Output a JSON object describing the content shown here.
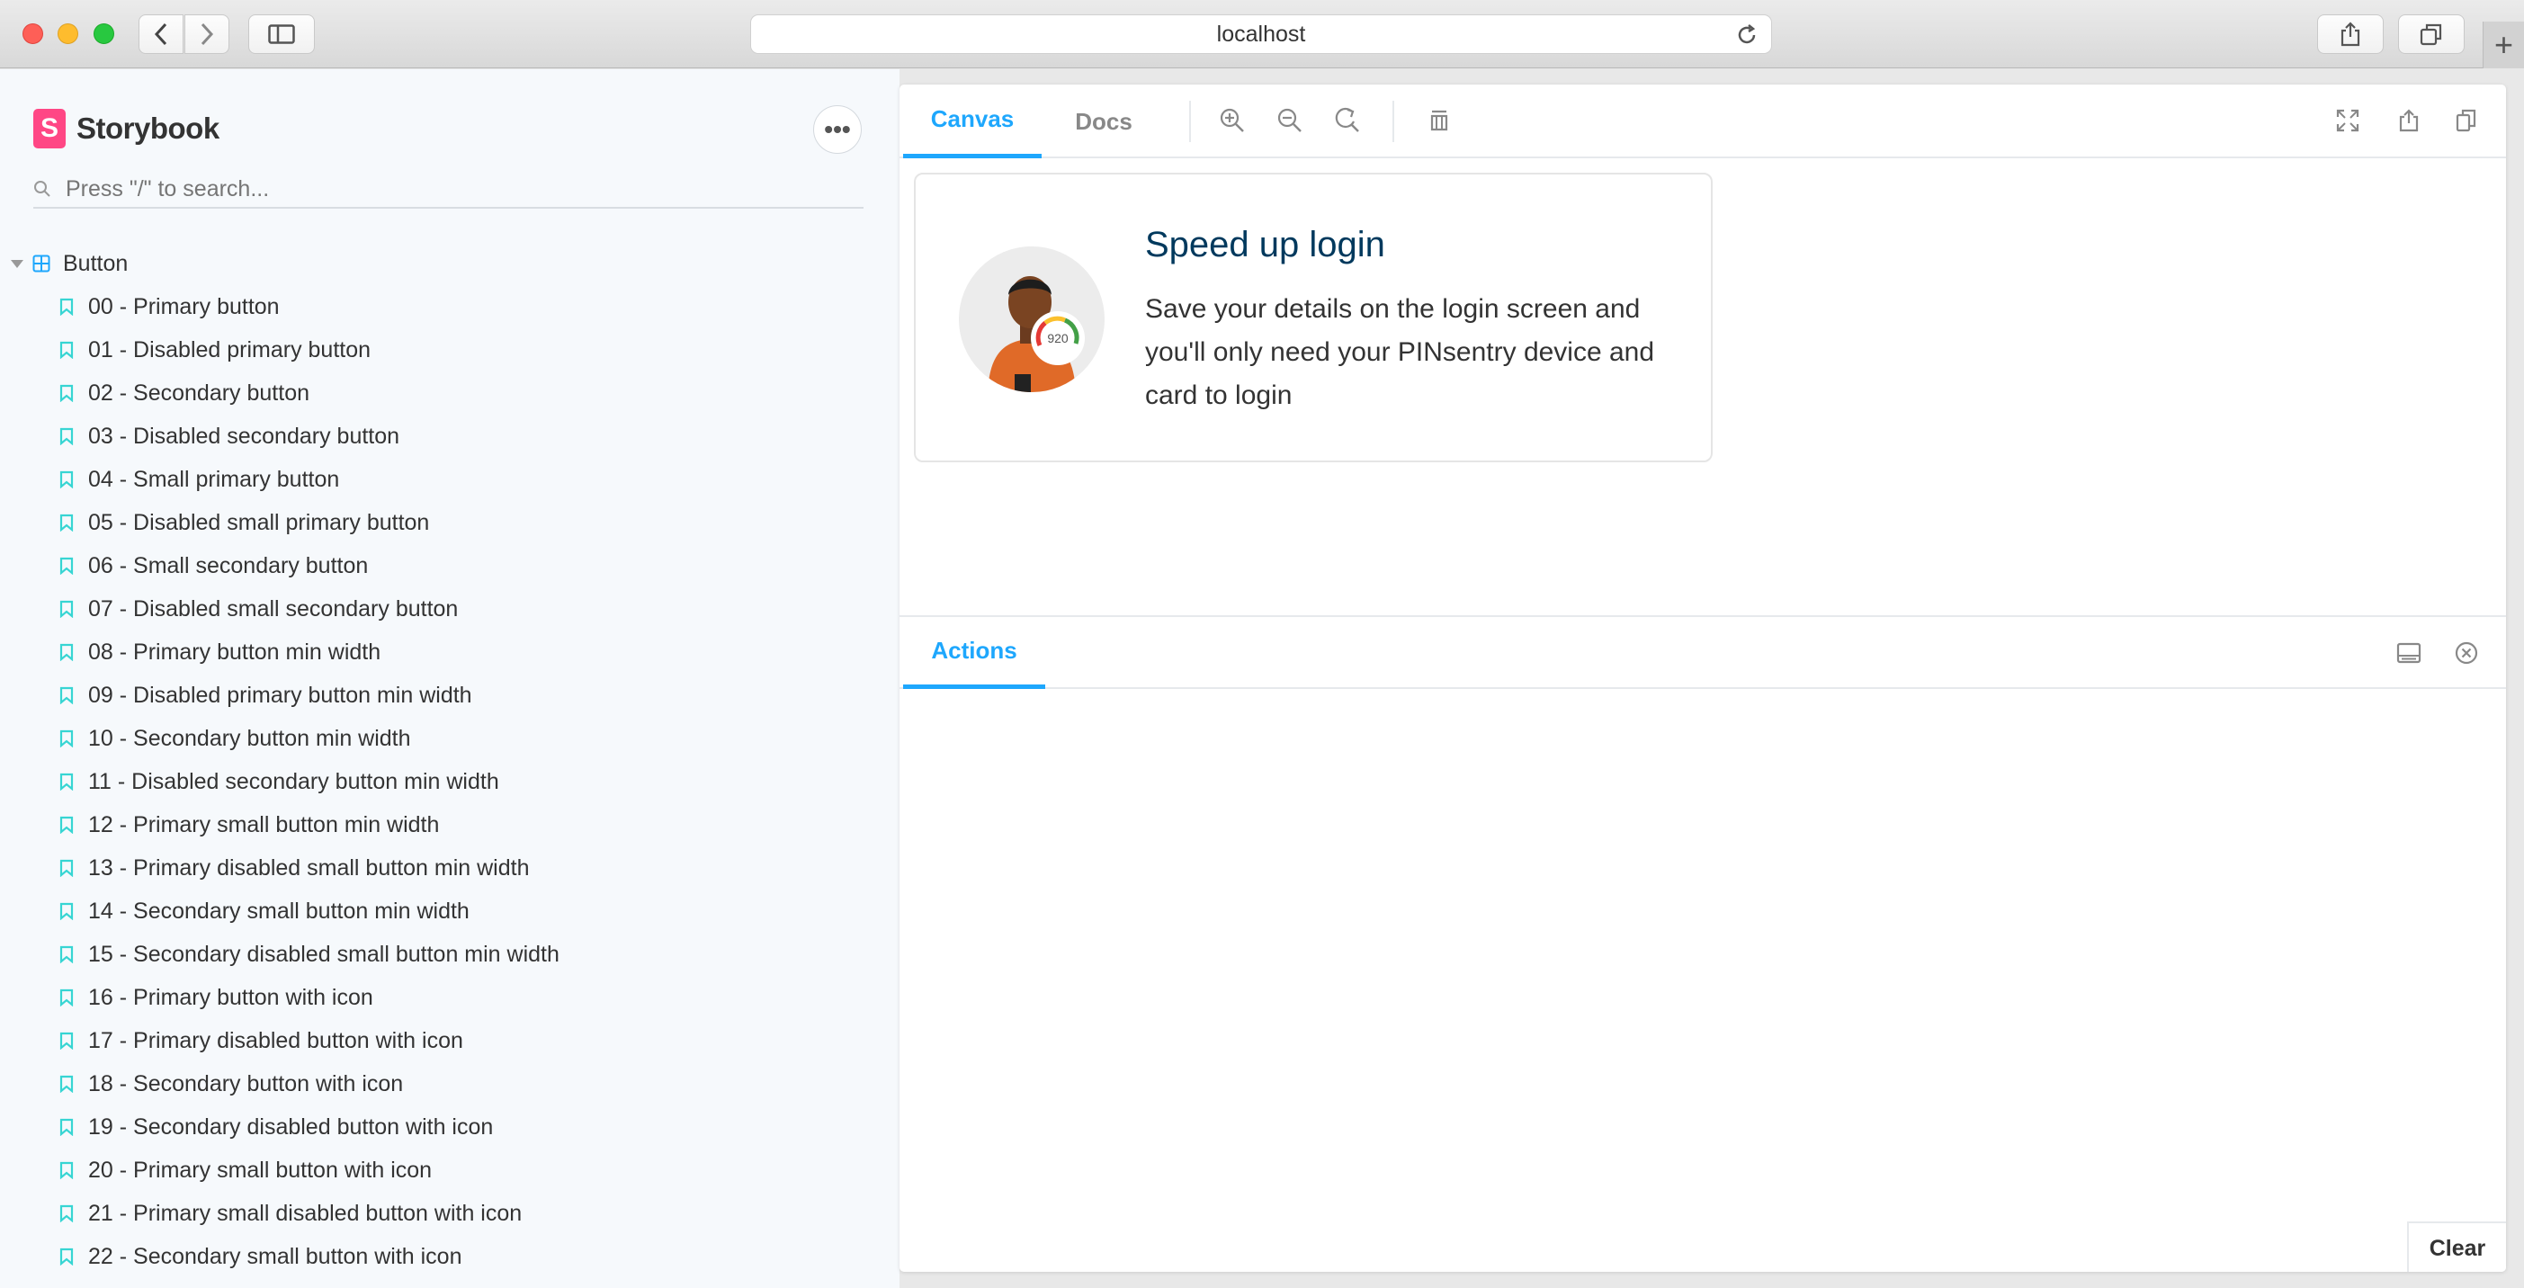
{
  "browser": {
    "url": "localhost"
  },
  "sidebar": {
    "brand": "Storybook",
    "menu_icon": "ellipsis-icon",
    "search_placeholder": "Press \"/\" to search...",
    "root": "Button",
    "stories": [
      "00 - Primary button",
      "01 - Disabled primary button",
      "02 - Secondary button",
      "03 - Disabled secondary button",
      "04 - Small primary button",
      "05 - Disabled small primary button",
      "06 - Small secondary button",
      "07 - Disabled small secondary button",
      "08 - Primary button min width",
      "09 - Disabled primary button min width",
      "10 - Secondary button min width",
      "11 - Disabled secondary button min width",
      "12 - Primary small button min width",
      "13 - Primary disabled small button min width",
      "14 - Secondary small button min width",
      "15 - Secondary disabled small button min width",
      "16 - Primary button with icon",
      "17 - Primary disabled button with icon",
      "18 - Secondary button with icon",
      "19 - Secondary disabled button with icon",
      "20 - Primary small button with icon",
      "21 - Primary small disabled button with icon",
      "22 - Secondary small button with icon"
    ]
  },
  "toolbar": {
    "tabs": [
      "Canvas",
      "Docs"
    ],
    "active_tab": "Canvas"
  },
  "card": {
    "title": "Speed up login",
    "body": "Save your details on the login screen and you'll only need your PINsentry device and card to login",
    "gauge_value": "920"
  },
  "addons": {
    "tab": "Actions",
    "clear_label": "Clear"
  },
  "colors": {
    "accent": "#1ea7fd",
    "brand": "#ff4785",
    "story_icon": "#37d5d3",
    "card_title": "#00395d"
  }
}
